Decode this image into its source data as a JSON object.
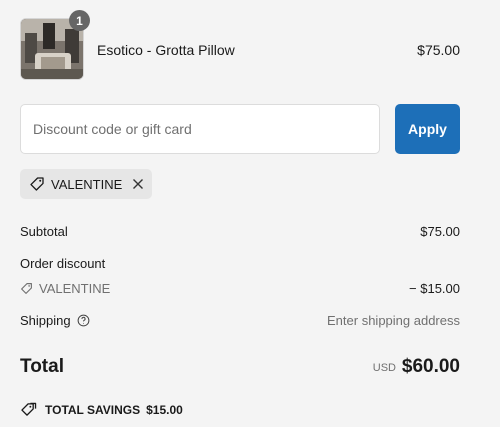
{
  "product": {
    "name": "Esotico - Grotta Pillow",
    "price": "$75.00",
    "quantity": "1",
    "image_icon": "product-thumbnail"
  },
  "discount": {
    "placeholder": "Discount code or gift card",
    "value": "",
    "apply_label": "Apply",
    "applied_code": "VALENTINE"
  },
  "summary": {
    "subtotal_label": "Subtotal",
    "subtotal_value": "$75.00",
    "order_discount_label": "Order discount",
    "discount_code": "VALENTINE",
    "discount_value": "− $15.00",
    "shipping_label": "Shipping",
    "shipping_value": "Enter shipping address",
    "total_label": "Total",
    "total_currency": "USD",
    "total_value": "$60.00",
    "savings_label": "TOTAL SAVINGS",
    "savings_value": "$15.00"
  },
  "colors": {
    "background": "#f4f4f4",
    "accent": "#1d6fb8",
    "chip": "#e6e6e6",
    "muted_text": "#707070"
  }
}
